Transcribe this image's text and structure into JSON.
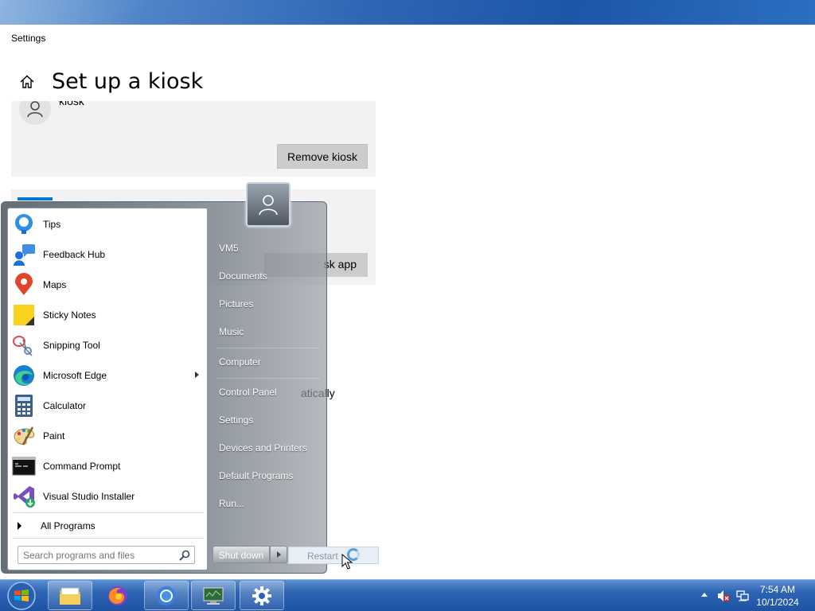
{
  "window": {
    "title": "Settings",
    "page_title": "Set up a kiosk"
  },
  "kiosk_card": {
    "name": "kiosk",
    "remove_label": "Remove kiosk"
  },
  "app_card": {
    "button_label": "sk app"
  },
  "partial_text": "atically",
  "start_menu": {
    "programs": [
      {
        "label": "Tips",
        "icon": "tips-icon"
      },
      {
        "label": "Feedback Hub",
        "icon": "feedback-hub-icon"
      },
      {
        "label": "Maps",
        "icon": "maps-icon"
      },
      {
        "label": "Sticky Notes",
        "icon": "sticky-notes-icon"
      },
      {
        "label": "Snipping Tool",
        "icon": "snipping-tool-icon"
      },
      {
        "label": "Microsoft Edge",
        "icon": "edge-icon"
      },
      {
        "label": "Calculator",
        "icon": "calculator-icon"
      },
      {
        "label": "Paint",
        "icon": "paint-icon"
      },
      {
        "label": "Command Prompt",
        "icon": "command-prompt-icon"
      },
      {
        "label": "Visual Studio Installer",
        "icon": "vs-installer-icon"
      }
    ],
    "all_programs": "All Programs",
    "search_placeholder": "Search programs and files",
    "right_items": [
      {
        "label": "VM5"
      },
      {
        "label": "Documents"
      },
      {
        "label": "Pictures"
      },
      {
        "label": "Music"
      },
      {
        "label": "Computer"
      },
      {
        "label": "Control Panel"
      },
      {
        "label": "Settings"
      },
      {
        "label": "Devices and Printers"
      },
      {
        "label": "Default Programs"
      },
      {
        "label": "Run..."
      }
    ],
    "shutdown_label": "Shut down",
    "restart_label": "Restart"
  },
  "taskbar": {
    "apps": [
      "file-explorer-icon",
      "firefox-icon",
      "chrome-icon",
      "monitor-icon",
      "settings-gear-icon"
    ],
    "time": "7:54 AM",
    "date": "10/1/2024"
  },
  "colors": {
    "accent": "#0078d4",
    "taskbar": "#2c63b2",
    "card_bg": "#f2f2f2",
    "button_bg": "#cccccc"
  }
}
